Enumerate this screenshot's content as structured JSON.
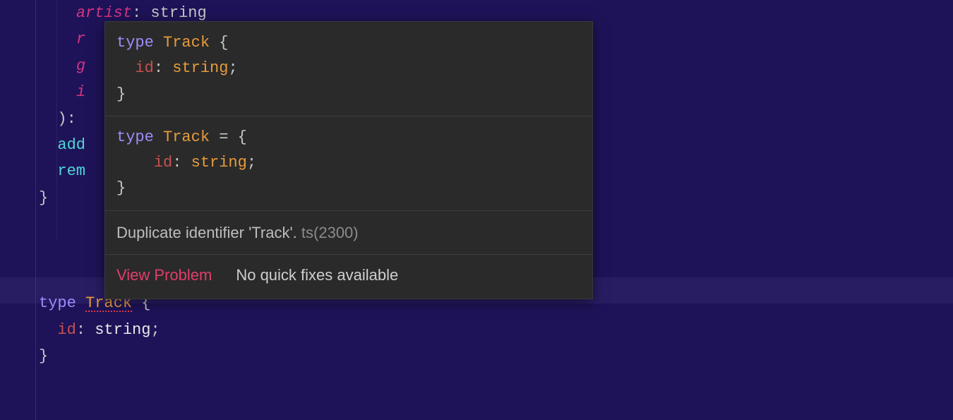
{
  "code": {
    "line1_prop": "artist",
    "line1_type_text": ": string",
    "line2_prop": "r",
    "line3_prop": "g",
    "line4_prop": "i",
    "line5": "):",
    "line6_fn": "add",
    "line7_fn": "rem",
    "line8_brace": "}",
    "line10_kw": "type",
    "line10_name": "Track",
    "line10_brace": " {",
    "line11_prop": "id",
    "line11_punct": ": ",
    "line11_type": "string",
    "line11_semi": ";",
    "line12_brace": "}"
  },
  "hover": {
    "code1_kw": "type",
    "code1_name": " Track",
    "code1_rest": " {",
    "code1_l2_indent": "  ",
    "code1_l2_prop": "id",
    "code1_l2_punct": ": ",
    "code1_l2_type": "string",
    "code1_l2_semi": ";",
    "code1_l3": "}",
    "code2_kw": "type",
    "code2_name": " Track",
    "code2_rest": " = {",
    "code2_l2_indent": "    ",
    "code2_l2_prop": "id",
    "code2_l2_punct": ": ",
    "code2_l2_type": "string",
    "code2_l2_semi": ";",
    "code2_l3": "}",
    "message_main": "Duplicate identifier 'Track'. ",
    "message_code": "ts(2300)",
    "view_problem": "View Problem",
    "no_fix": "No quick fixes available"
  }
}
